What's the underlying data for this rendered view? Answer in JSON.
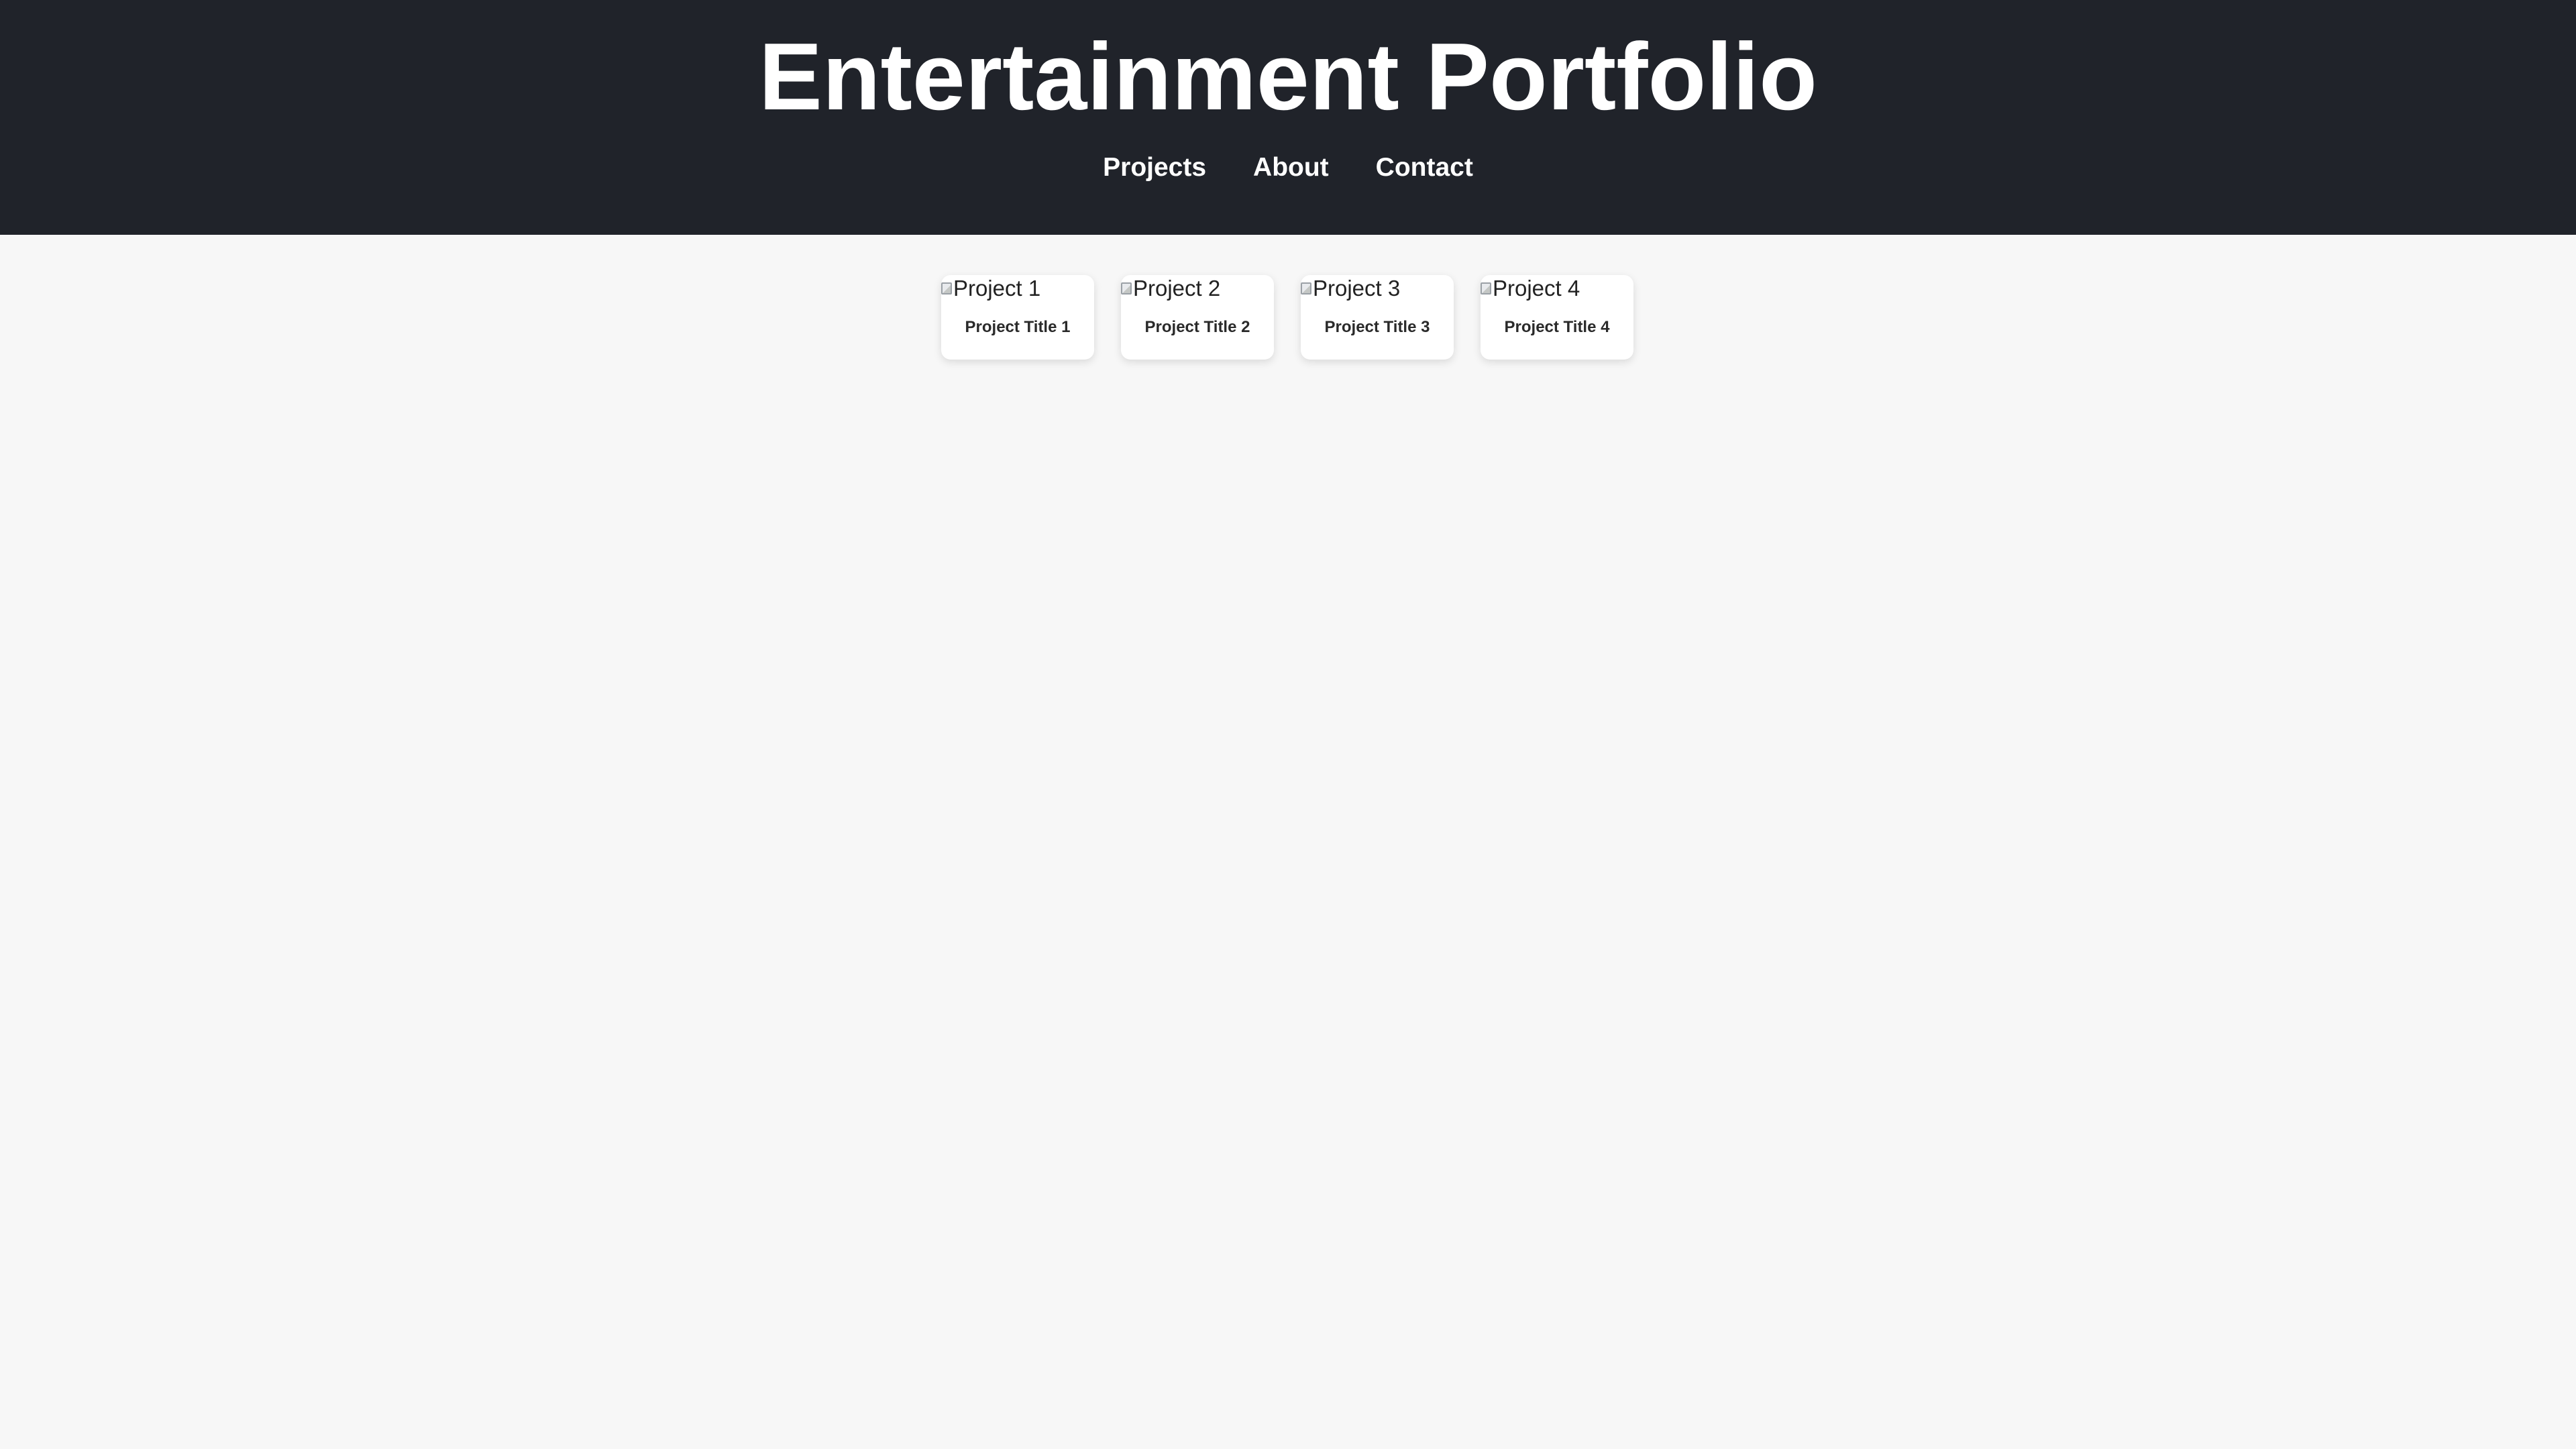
{
  "header": {
    "title": "Entertainment Portfolio",
    "nav": [
      {
        "label": "Projects"
      },
      {
        "label": "About"
      },
      {
        "label": "Contact"
      }
    ]
  },
  "projects": [
    {
      "image_alt": "Project 1",
      "title": "Project Title 1"
    },
    {
      "image_alt": "Project 2",
      "title": "Project Title 2"
    },
    {
      "image_alt": "Project 3",
      "title": "Project Title 3"
    },
    {
      "image_alt": "Project 4",
      "title": "Project Title 4"
    }
  ],
  "colors": {
    "header_bg": "#20232a",
    "page_bg": "#f7f7f7",
    "card_bg": "#ffffff",
    "header_text": "#ffffff"
  }
}
